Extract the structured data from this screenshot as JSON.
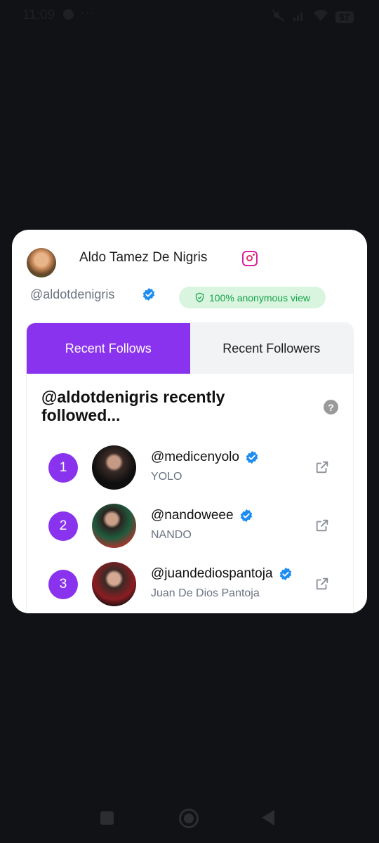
{
  "status_bar": {
    "time": "11:09",
    "more": "···",
    "battery": "57"
  },
  "profile": {
    "name": "Aldo Tamez De Nigris",
    "handle": "@aldotdenigris",
    "anonymous_badge": "100% anonymous view",
    "platform_icon": "instagram-icon"
  },
  "tabs": [
    {
      "label": "Recent Follows",
      "active": true
    },
    {
      "label": "Recent Followers",
      "active": false
    }
  ],
  "list": {
    "title": "@aldotdenigris recently followed...",
    "help": "?",
    "items": [
      {
        "rank": "1",
        "handle": "@medicenyolo",
        "name": "YOLO"
      },
      {
        "rank": "2",
        "handle": "@nandoweee",
        "name": "NANDO"
      },
      {
        "rank": "3",
        "handle": "@juandediospantoja",
        "name": "Juan De Dios Pantoja"
      }
    ]
  },
  "colors": {
    "accent": "#8a33ee",
    "verified": "#1d8cf0",
    "badge_bg": "#d9f4df",
    "badge_text": "#16a34a"
  }
}
